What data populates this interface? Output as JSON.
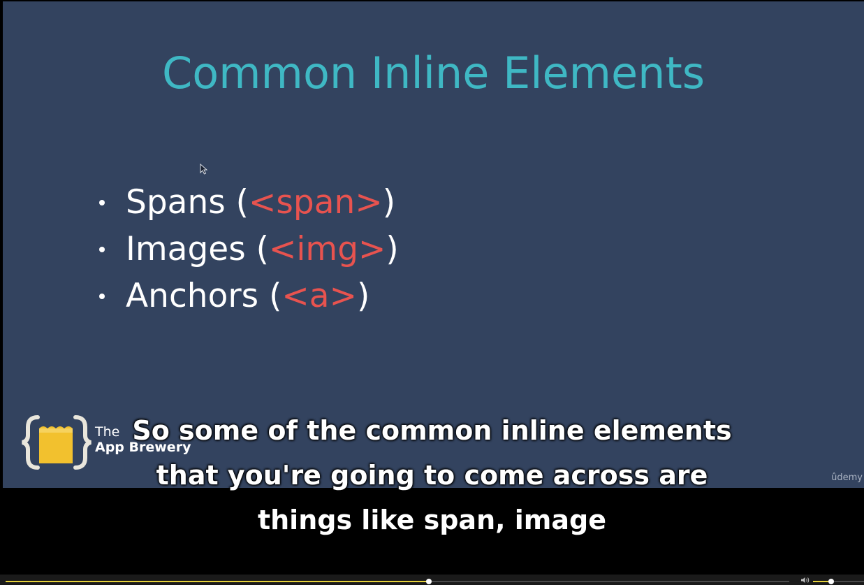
{
  "slide": {
    "title": "Common Inline Elements",
    "bullets": [
      {
        "label": "Spans (",
        "tag": "<span>",
        "close": ")"
      },
      {
        "label": "Images (",
        "tag": "<img>",
        "close": ")"
      },
      {
        "label": "Anchors (",
        "tag": "<a>",
        "close": ")"
      }
    ],
    "logo": {
      "line1": "The",
      "line2": "App Brewery",
      "icon": "braces-mug-icon"
    },
    "watermark": "ûdemy"
  },
  "captions": [
    "So some of the common inline elements",
    "that you're going to come across are",
    "things like span, image"
  ],
  "player": {
    "progress_fraction": 0.54,
    "volume_fraction": 0.36
  },
  "colors": {
    "slide_background": "#33435f",
    "title": "#3fb8c4",
    "tag": "#e8534f",
    "accent": "#e6d23a",
    "logo_mug": "#f2c12e"
  }
}
